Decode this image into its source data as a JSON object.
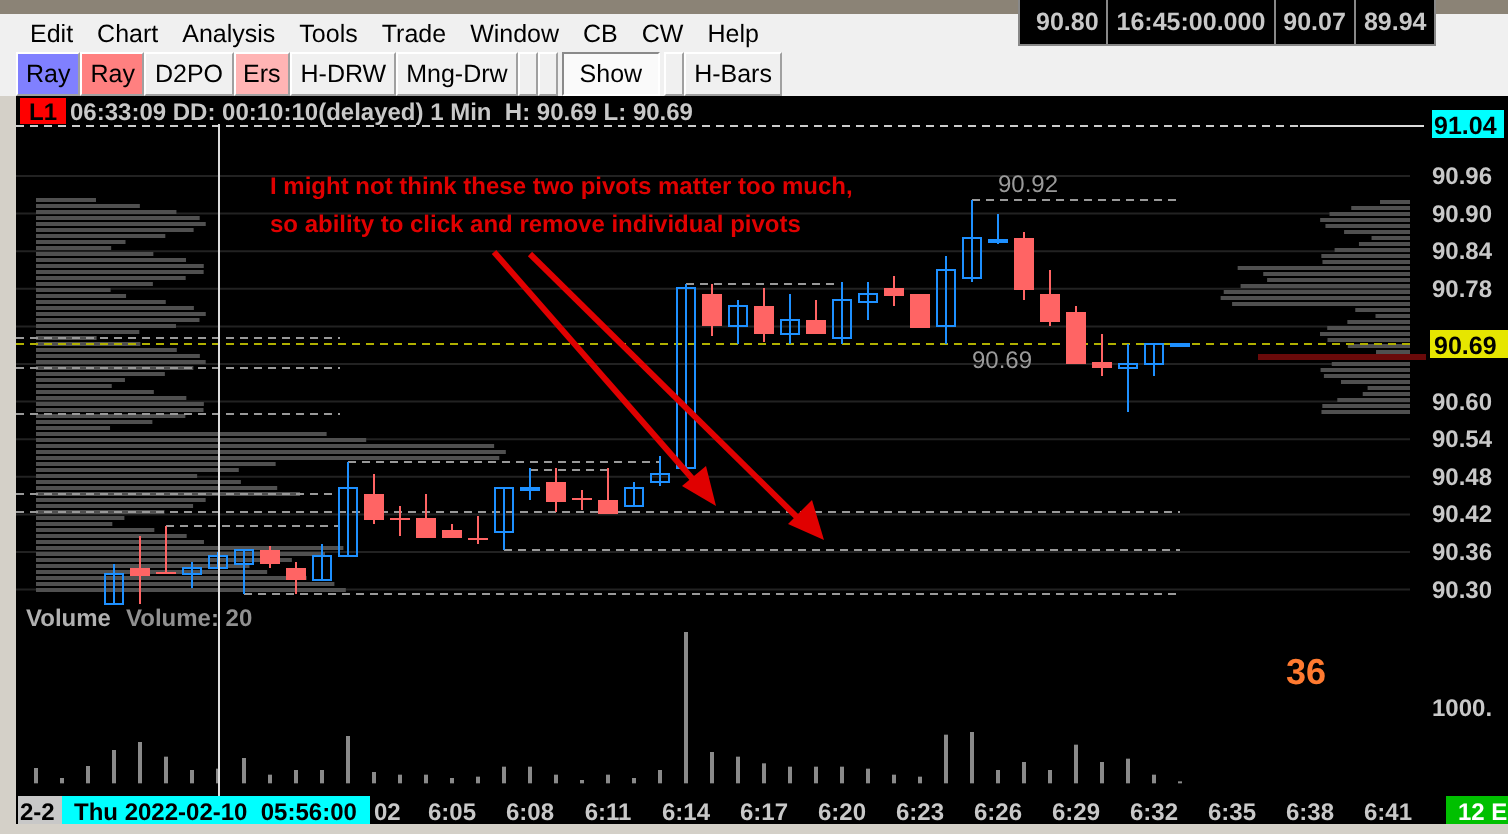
{
  "menu": [
    "Edit",
    "Chart",
    "Analysis",
    "Tools",
    "Trade",
    "Window",
    "CB",
    "CW",
    "Help"
  ],
  "quote": [
    "90.80",
    "16:45:00.000",
    "90.07",
    "89.94"
  ],
  "toolbar": [
    {
      "kind": "button",
      "label": "Ray",
      "color": "#8080ff",
      "pressed": false
    },
    {
      "kind": "button",
      "label": "Ray",
      "color": "#ff8080",
      "pressed": false
    },
    {
      "kind": "button",
      "label": "D2PO",
      "pressed": false
    },
    {
      "kind": "button",
      "label": "Ers",
      "color": "#ffb4b4",
      "pressed": false
    },
    {
      "kind": "button",
      "label": "H-DRW",
      "pressed": false
    },
    {
      "kind": "button",
      "label": "Mng-Drw",
      "pressed": false
    },
    {
      "kind": "blank",
      "pressed": false
    },
    {
      "kind": "blank",
      "pressed": false
    },
    {
      "kind": "button",
      "label": "Show",
      "pressed": true
    },
    {
      "kind": "blank",
      "pressed": false
    },
    {
      "kind": "button",
      "label": "H-Bars",
      "pressed": false
    }
  ],
  "chart": {
    "symbol_badge": "L1",
    "info": "06:33:09 DD: 00:10:10(delayed) 1 Min  H: 90.69 L: 90.69",
    "annotation": [
      "I might not think these two pivots matter too much,",
      "so ability to click and remove individual pivots"
    ],
    "high_marker": "91.04",
    "last_price": "90.69",
    "price_axis": [
      "90.96",
      "90.90",
      "90.84",
      "90.78",
      "90.60",
      "90.54",
      "90.48",
      "90.42",
      "90.36",
      "90.30"
    ],
    "pivot_labels": [
      "90.92",
      "90.69"
    ],
    "volume_title": "Volume",
    "volume_reading": "Volume: 20",
    "counter": "36",
    "volume_axis": "1000.",
    "time_axis": {
      "start_badge": "2-2",
      "cursor_time": "Thu 2022-02-10  05:56:00",
      "labels": [
        "02",
        "6:05",
        "6:08",
        "6:11",
        "6:14",
        "6:17",
        "6:20",
        "6:23",
        "6:26",
        "6:29",
        "6:32",
        "6:35",
        "6:38",
        "6:41"
      ],
      "end_badge": "12 E"
    }
  }
}
